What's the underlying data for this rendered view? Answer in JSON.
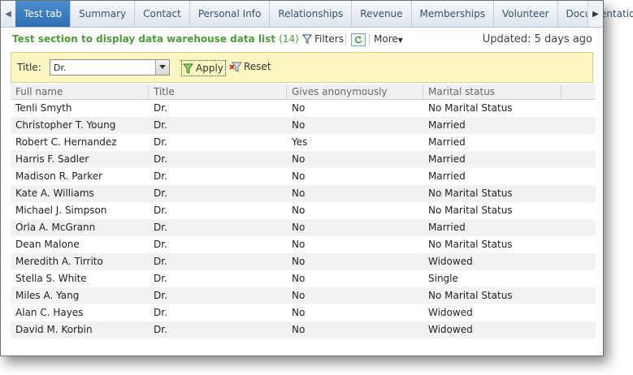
{
  "tabs": [
    {
      "label": "Test tab",
      "active": true
    },
    {
      "label": "Summary",
      "active": false
    },
    {
      "label": "Contact",
      "active": false
    },
    {
      "label": "Personal Info",
      "active": false
    },
    {
      "label": "Relationships",
      "active": false
    },
    {
      "label": "Revenue",
      "active": false
    },
    {
      "label": "Memberships",
      "active": false
    },
    {
      "label": "Volunteer",
      "active": false
    },
    {
      "label": "Documentation",
      "active": false
    }
  ],
  "header": {
    "title": "Test section to display data warehouse data list",
    "count": "(14)",
    "filters_label": "Filters",
    "more_label": "More",
    "updated": "Updated: 5 days ago"
  },
  "filter": {
    "title_label": "Title:",
    "title_value": "Dr.",
    "apply_label": "Apply",
    "reset_label": "Reset"
  },
  "table": {
    "columns": [
      "Full name",
      "Title",
      "Gives anonymously",
      "Marital status"
    ],
    "rows": [
      [
        "Tenli Smyth",
        "Dr.",
        "No",
        "No Marital Status"
      ],
      [
        "Christopher T. Young",
        "Dr.",
        "No",
        "Married"
      ],
      [
        "Robert C. Hernandez",
        "Dr.",
        "Yes",
        "Married"
      ],
      [
        "Harris F. Sadler",
        "Dr.",
        "No",
        "Married"
      ],
      [
        "Madison R. Parker",
        "Dr.",
        "No",
        "Married"
      ],
      [
        "Kate A. Williams",
        "Dr.",
        "No",
        "No Marital Status"
      ],
      [
        "Michael J. Simpson",
        "Dr.",
        "No",
        "No Marital Status"
      ],
      [
        "Orla A. McGrann",
        "Dr.",
        "No",
        "Married"
      ],
      [
        "Dean Malone",
        "Dr.",
        "No",
        "No Marital Status"
      ],
      [
        "Meredith A. Tirrito",
        "Dr.",
        "No",
        "Widowed"
      ],
      [
        "Stella S. White",
        "Dr.",
        "No",
        "Single"
      ],
      [
        "Miles A. Yang",
        "Dr.",
        "No",
        "No Marital Status"
      ],
      [
        "Alan C. Hayes",
        "Dr.",
        "No",
        "Widowed"
      ],
      [
        "David M. Korbin",
        "Dr.",
        "No",
        "Widowed"
      ]
    ]
  },
  "colors": {
    "active_tab": "#3b7ec2",
    "section_title": "#4e9a3c",
    "filter_bar": "#fbf6c2"
  }
}
